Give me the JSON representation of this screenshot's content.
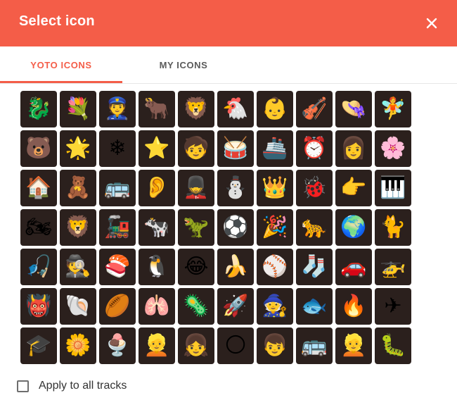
{
  "dialog": {
    "title": "Select icon",
    "close_icon": "close-icon",
    "accent": "#f45d48"
  },
  "tabs": [
    {
      "label": "YOTO ICONS",
      "active": true
    },
    {
      "label": "MY ICONS",
      "active": false
    }
  ],
  "icons": [
    {
      "name": "dragon-icon",
      "glyph": "🐉"
    },
    {
      "name": "bouquet-icon",
      "glyph": "💐"
    },
    {
      "name": "police-officer-icon",
      "glyph": "👮"
    },
    {
      "name": "ox-icon",
      "glyph": "🐂"
    },
    {
      "name": "lion-icon",
      "glyph": "🦁"
    },
    {
      "name": "chicken-icon",
      "glyph": "🐔"
    },
    {
      "name": "baby-icon",
      "glyph": "👶"
    },
    {
      "name": "violin-icon",
      "glyph": "🎻"
    },
    {
      "name": "hat-icon",
      "glyph": "👒"
    },
    {
      "name": "fairy-icon",
      "glyph": "🧚"
    },
    {
      "name": "bears-icon",
      "glyph": "🐻"
    },
    {
      "name": "sparkle-star-icon",
      "glyph": "🌟"
    },
    {
      "name": "snowflake-icon",
      "glyph": "❄"
    },
    {
      "name": "star-icon",
      "glyph": "⭐"
    },
    {
      "name": "child-face-icon",
      "glyph": "🧒"
    },
    {
      "name": "drum-icon",
      "glyph": "🥁"
    },
    {
      "name": "ship-icon",
      "glyph": "🚢"
    },
    {
      "name": "alarm-clock-icon",
      "glyph": "⏰"
    },
    {
      "name": "woman-face-icon",
      "glyph": "👩"
    },
    {
      "name": "flower-icon",
      "glyph": "🌸"
    },
    {
      "name": "house-icon",
      "glyph": "🏠"
    },
    {
      "name": "teddy-bear-icon",
      "glyph": "🧸"
    },
    {
      "name": "london-bus-icon",
      "glyph": "🚌"
    },
    {
      "name": "ear-icon",
      "glyph": "👂"
    },
    {
      "name": "guard-icon",
      "glyph": "💂"
    },
    {
      "name": "snowman-icon",
      "glyph": "⛄"
    },
    {
      "name": "crown-icon",
      "glyph": "👑"
    },
    {
      "name": "ladybug-icon",
      "glyph": "🐞"
    },
    {
      "name": "pointing-hand-icon",
      "glyph": "👉"
    },
    {
      "name": "piano-keys-icon",
      "glyph": "🎹"
    },
    {
      "name": "motorcycle-icon",
      "glyph": "🏍"
    },
    {
      "name": "lion-face-icon",
      "glyph": "🦁"
    },
    {
      "name": "train-icon",
      "glyph": "🚂"
    },
    {
      "name": "cow-icon",
      "glyph": "🐄"
    },
    {
      "name": "dinosaur-icon",
      "glyph": "🦖"
    },
    {
      "name": "soccer-ball-icon",
      "glyph": "⚽"
    },
    {
      "name": "party-popper-icon",
      "glyph": "🎉"
    },
    {
      "name": "leopard-icon",
      "glyph": "🐆"
    },
    {
      "name": "globe-icon",
      "glyph": "🌍"
    },
    {
      "name": "cat-icon",
      "glyph": "🐈"
    },
    {
      "name": "fishing-pole-icon",
      "glyph": "🎣"
    },
    {
      "name": "detective-icon",
      "glyph": "🕵"
    },
    {
      "name": "sushi-icon",
      "glyph": "🍣"
    },
    {
      "name": "penguin-icon",
      "glyph": "🐧"
    },
    {
      "name": "crying-laughing-icon",
      "glyph": "😂"
    },
    {
      "name": "banana-icon",
      "glyph": "🍌"
    },
    {
      "name": "baseball-icon",
      "glyph": "⚾"
    },
    {
      "name": "sock-icon",
      "glyph": "🧦"
    },
    {
      "name": "car-icon",
      "glyph": "🚗"
    },
    {
      "name": "helicopter-icon",
      "glyph": "🚁"
    },
    {
      "name": "devil-mask-icon",
      "glyph": "👹"
    },
    {
      "name": "shell-icon",
      "glyph": "🐚"
    },
    {
      "name": "rugby-ball-icon",
      "glyph": "🏉"
    },
    {
      "name": "lungs-icon",
      "glyph": "🫁"
    },
    {
      "name": "germ-icon",
      "glyph": "🦠"
    },
    {
      "name": "rocket-icon",
      "glyph": "🚀"
    },
    {
      "name": "witch-hat-icon",
      "glyph": "🧙"
    },
    {
      "name": "fish-icon",
      "glyph": "🐟"
    },
    {
      "name": "fire-icon",
      "glyph": "🔥"
    },
    {
      "name": "airplane-icon",
      "glyph": "✈"
    },
    {
      "name": "graduation-cap-icon",
      "glyph": "🎓"
    },
    {
      "name": "daisy-icon",
      "glyph": "🌼"
    },
    {
      "name": "ice-cream-icon",
      "glyph": "🍨"
    },
    {
      "name": "blonde-person-icon",
      "glyph": "👱"
    },
    {
      "name": "girl-face-icon",
      "glyph": "👧"
    },
    {
      "name": "moon-icon",
      "glyph": "🌕"
    },
    {
      "name": "boy-face-icon",
      "glyph": "👦"
    },
    {
      "name": "school-bus-icon",
      "glyph": "🚌"
    },
    {
      "name": "blond-boy-icon",
      "glyph": "👱"
    },
    {
      "name": "caterpillar-icon",
      "glyph": "🐛"
    }
  ],
  "footer": {
    "apply_label": "Apply to all tracks",
    "apply_checked": false
  }
}
